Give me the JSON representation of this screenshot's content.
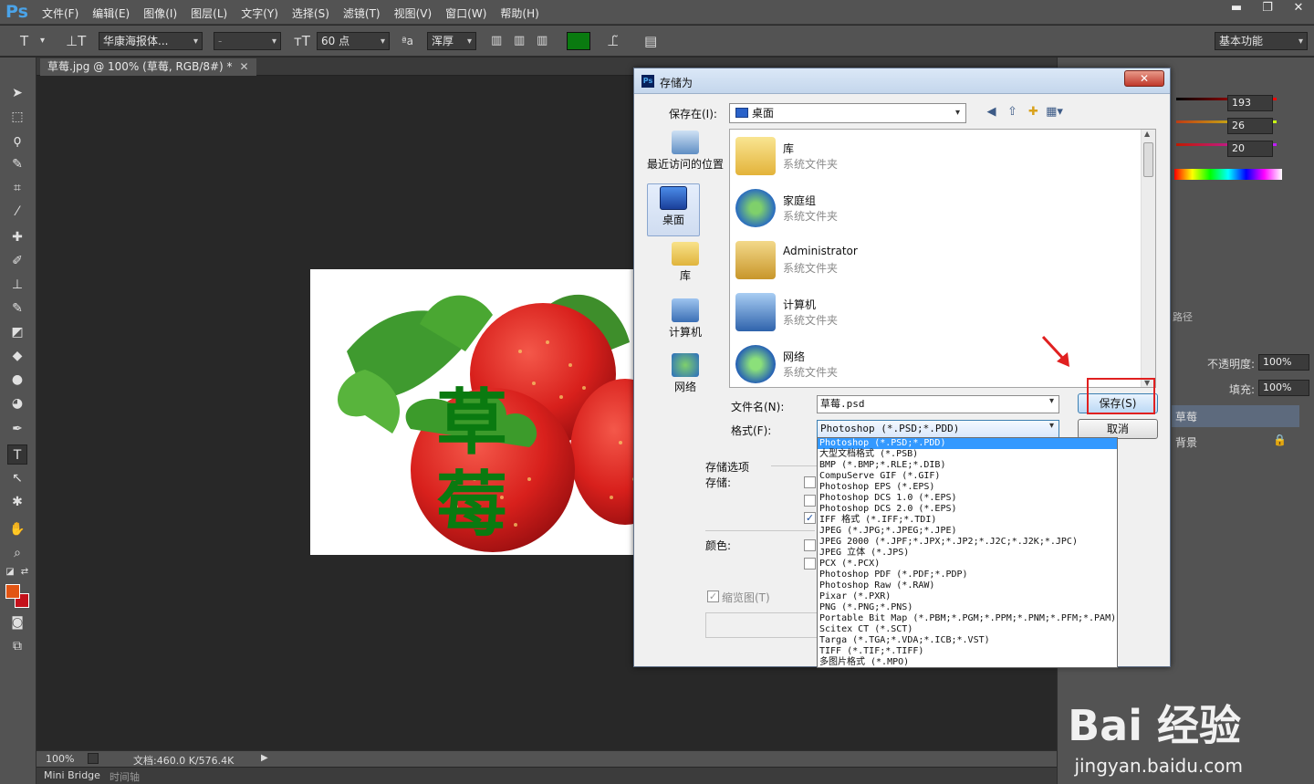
{
  "app": {
    "logo": "Ps",
    "menu": [
      "文件(F)",
      "编辑(E)",
      "图像(I)",
      "图层(L)",
      "文字(Y)",
      "选择(S)",
      "滤镜(T)",
      "视图(V)",
      "窗口(W)",
      "帮助(H)"
    ],
    "window_buttons": [
      "▬",
      "❐",
      "✕"
    ]
  },
  "options": {
    "font_family": "华康海报体...",
    "font_style": "-",
    "font_size": "60 点",
    "aa_label": "ªa",
    "antialias": "浑厚",
    "text_color": "#0a7a10",
    "workspace": "基本功能"
  },
  "document": {
    "tab_title": "草莓.jpg @ 100% (草莓, RGB/8#) *",
    "tab_close": "✕",
    "canvas_text": "草莓",
    "canvas_text_color": "#0a7a10"
  },
  "status": {
    "zoom": "100%",
    "doc_size": "文档:460.0 K/576.4K",
    "bottom_tabs": [
      "Mini Bridge",
      "时间轴"
    ]
  },
  "right_panel": {
    "rgb": [
      "193",
      "26",
      "20"
    ],
    "opacity_label": "不透明度:",
    "opacity": "100%",
    "fill_label": "填充:",
    "fill": "100%",
    "paths_tab": "路径",
    "layers": [
      "草莓",
      "背景"
    ]
  },
  "dialog": {
    "title": "存储为",
    "close": "✕",
    "save_in_label": "保存在(I):",
    "save_in_value": "桌面",
    "places": [
      "最近访问的位置",
      "桌面",
      "库",
      "计算机",
      "网络"
    ],
    "files": [
      {
        "name": "库",
        "type": "系统文件夹"
      },
      {
        "name": "家庭组",
        "type": "系统文件夹"
      },
      {
        "name": "Administrator",
        "type": "系统文件夹"
      },
      {
        "name": "计算机",
        "type": "系统文件夹"
      },
      {
        "name": "网络",
        "type": "系统文件夹"
      }
    ],
    "filename_label": "文件名(N):",
    "filename": "草莓.psd",
    "format_label": "格式(F):",
    "format": "Photoshop (*.PSD;*.PDD)",
    "save_button": "保存(S)",
    "cancel_button": "取消",
    "options_title": "存储选项",
    "save_label": "存储:",
    "color_label": "颜色:",
    "thumbnail_label": "缩览图(T)",
    "format_options": [
      "Photoshop (*.PSD;*.PDD)",
      "大型文档格式 (*.PSB)",
      "BMP (*.BMP;*.RLE;*.DIB)",
      "CompuServe GIF (*.GIF)",
      "Photoshop EPS (*.EPS)",
      "Photoshop DCS 1.0 (*.EPS)",
      "Photoshop DCS 2.0 (*.EPS)",
      "IFF 格式 (*.IFF;*.TDI)",
      "JPEG (*.JPG;*.JPEG;*.JPE)",
      "JPEG 2000 (*.JPF;*.JPX;*.JP2;*.J2C;*.J2K;*.JPC)",
      "JPEG 立体 (*.JPS)",
      "PCX (*.PCX)",
      "Photoshop PDF (*.PDF;*.PDP)",
      "Photoshop Raw (*.RAW)",
      "Pixar (*.PXR)",
      "PNG (*.PNG;*.PNS)",
      "Portable Bit Map (*.PBM;*.PGM;*.PPM;*.PNM;*.PFM;*.PAM)",
      "Scitex CT (*.SCT)",
      "Targa (*.TGA;*.VDA;*.ICB;*.VST)",
      "TIFF (*.TIF;*.TIFF)",
      "多图片格式 (*.MPO)"
    ]
  },
  "watermark": {
    "brand": "Bai 经验",
    "url": "jingyan.baidu.com"
  }
}
